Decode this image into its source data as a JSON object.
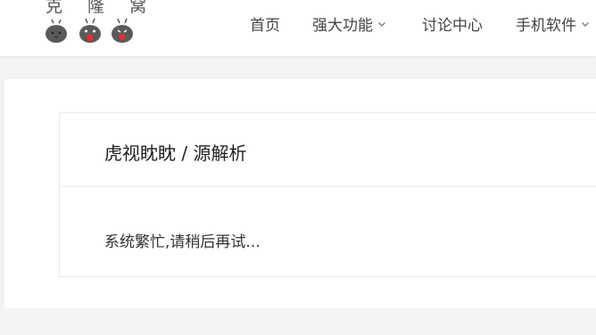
{
  "brand": {
    "logo_text": "克 隆 窝",
    "mascot_icons": [
      "gray-blob-face-icon",
      "red-mouth-blob-face-icon",
      "red-mouth-blob-face-icon"
    ]
  },
  "nav": {
    "items": [
      {
        "label": "首页",
        "has_dropdown": false
      },
      {
        "label": "强大功能",
        "has_dropdown": true
      },
      {
        "label": "讨论中心",
        "has_dropdown": false
      },
      {
        "label": "手机软件",
        "has_dropdown": true
      }
    ]
  },
  "panel": {
    "title": "虎视眈眈 / 源解析",
    "message": "系统繁忙,请稍后再试..."
  },
  "colors": {
    "header_bg": "#ffffff",
    "page_bg": "#f4f4f4",
    "mascot_body": "#5a5a5a",
    "mascot_mouth": "#e03030"
  }
}
